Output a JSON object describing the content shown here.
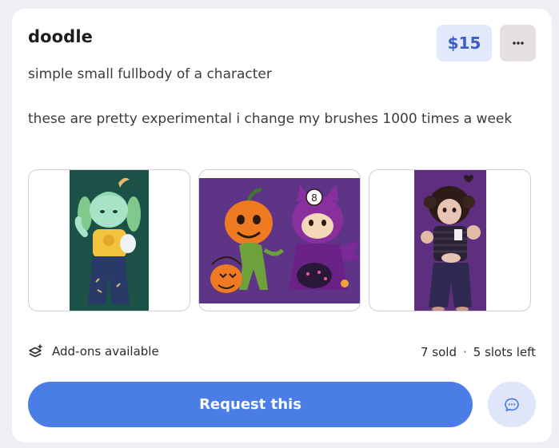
{
  "listing": {
    "title": "doodle",
    "price": "$15",
    "description_line1": "simple small fullbody of a character",
    "description_line2": "these are pretty experimental i change my brushes 1000 times a week"
  },
  "thumbnails": [
    {
      "name": "character-art-1"
    },
    {
      "name": "character-art-2"
    },
    {
      "name": "character-art-3"
    }
  ],
  "meta": {
    "addons_label": "Add-ons available",
    "sold": "7 sold",
    "separator": "·",
    "slots": "5 slots left"
  },
  "actions": {
    "request_label": "Request this"
  },
  "colors": {
    "accent": "#4a7de6",
    "price_bg": "#e2e9fb",
    "price_text": "#3a5fc5"
  }
}
